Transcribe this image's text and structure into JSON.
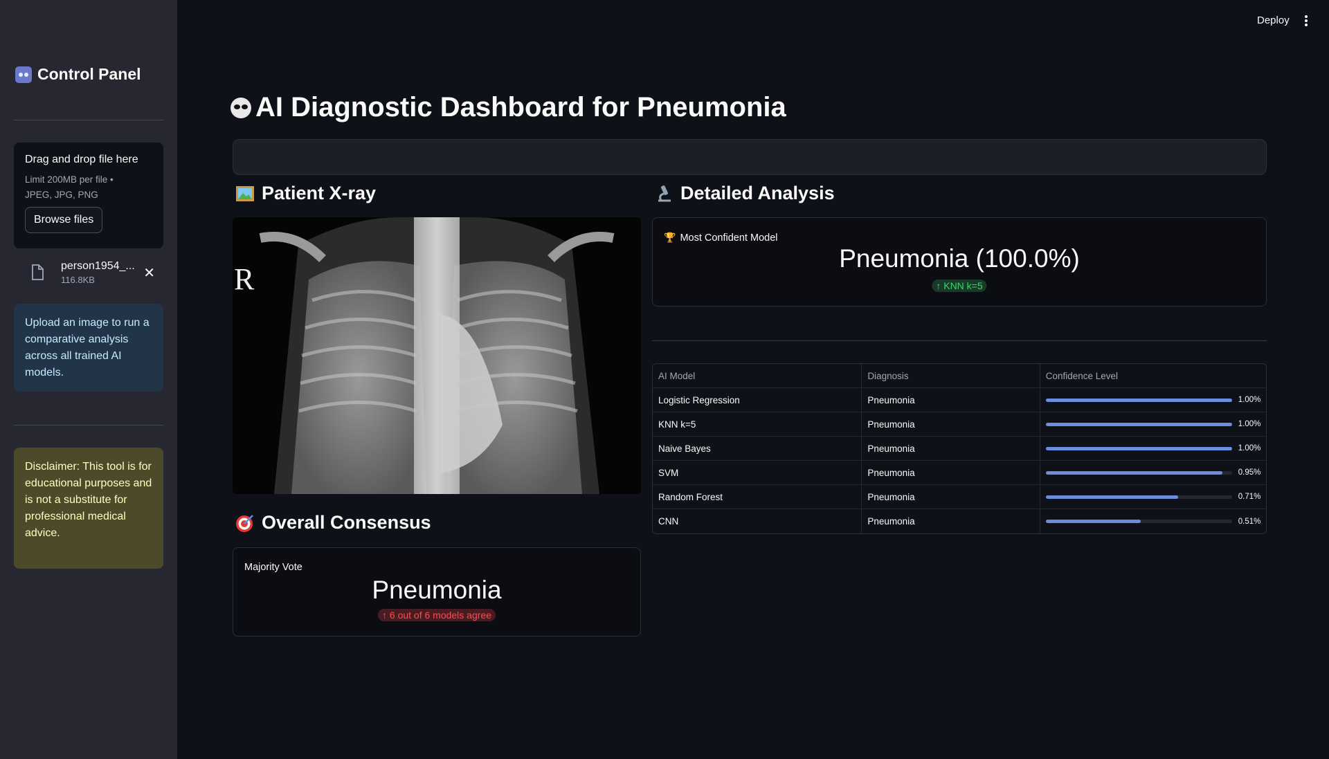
{
  "sidebar": {
    "title": "Control Panel",
    "uploader": {
      "drag_text": "Drag and drop file here",
      "limit_line1": "Limit 200MB per file •",
      "limit_line2": "JPEG, JPG, PNG",
      "browse_label": "Browse files"
    },
    "file": {
      "name": "person1954_...",
      "size": "116.8KB"
    },
    "info_text": "Upload an image to run a comparative analysis across all trained AI models.",
    "disclaimer_text": "Disclaimer: This tool is for educational purposes and is not a substitute for professional medical advice."
  },
  "topbar": {
    "deploy_label": "Deploy"
  },
  "main": {
    "title": "AI Diagnostic Dashboard for Pneumonia",
    "xray_heading": "Patient X-ray",
    "xray_marker": "R",
    "analysis_heading": "Detailed Analysis",
    "consensus_heading": "Overall Consensus",
    "most_confident": {
      "label": "Most Confident Model",
      "value": "Pneumonia (100.0%)",
      "delta": "↑ KNN k=5"
    },
    "majority": {
      "label": "Majority Vote",
      "value": "Pneumonia",
      "delta": "↑ 6 out of 6 models agree"
    },
    "table": {
      "headers": [
        "AI Model",
        "Diagnosis",
        "Confidence Level"
      ],
      "rows": [
        {
          "model": "Logistic Regression",
          "diagnosis": "Pneumonia",
          "confidence": 1.0,
          "confidence_label": "1.00%"
        },
        {
          "model": "KNN k=5",
          "diagnosis": "Pneumonia",
          "confidence": 1.0,
          "confidence_label": "1.00%"
        },
        {
          "model": "Naive Bayes",
          "diagnosis": "Pneumonia",
          "confidence": 1.0,
          "confidence_label": "1.00%"
        },
        {
          "model": "SVM",
          "diagnosis": "Pneumonia",
          "confidence": 0.95,
          "confidence_label": "0.95%"
        },
        {
          "model": "Random Forest",
          "diagnosis": "Pneumonia",
          "confidence": 0.71,
          "confidence_label": "0.71%"
        },
        {
          "model": "CNN",
          "diagnosis": "Pneumonia",
          "confidence": 0.51,
          "confidence_label": "0.51%"
        }
      ]
    }
  },
  "colors": {
    "background": "#0e1117",
    "sidebar": "#262730",
    "progress": "#6d8ee0",
    "delta_green": "#3dd56d",
    "delta_red": "#ff4b4b",
    "info_bg": "#213448",
    "warning_bg": "#4d4a2a"
  },
  "icons": {
    "sidebar_title": "control-knobs-icon",
    "main_title": "alien-icon",
    "xray": "framed-picture-icon",
    "analysis": "microscope-icon",
    "consensus": "target-icon",
    "most_confident": "trophy-icon"
  }
}
